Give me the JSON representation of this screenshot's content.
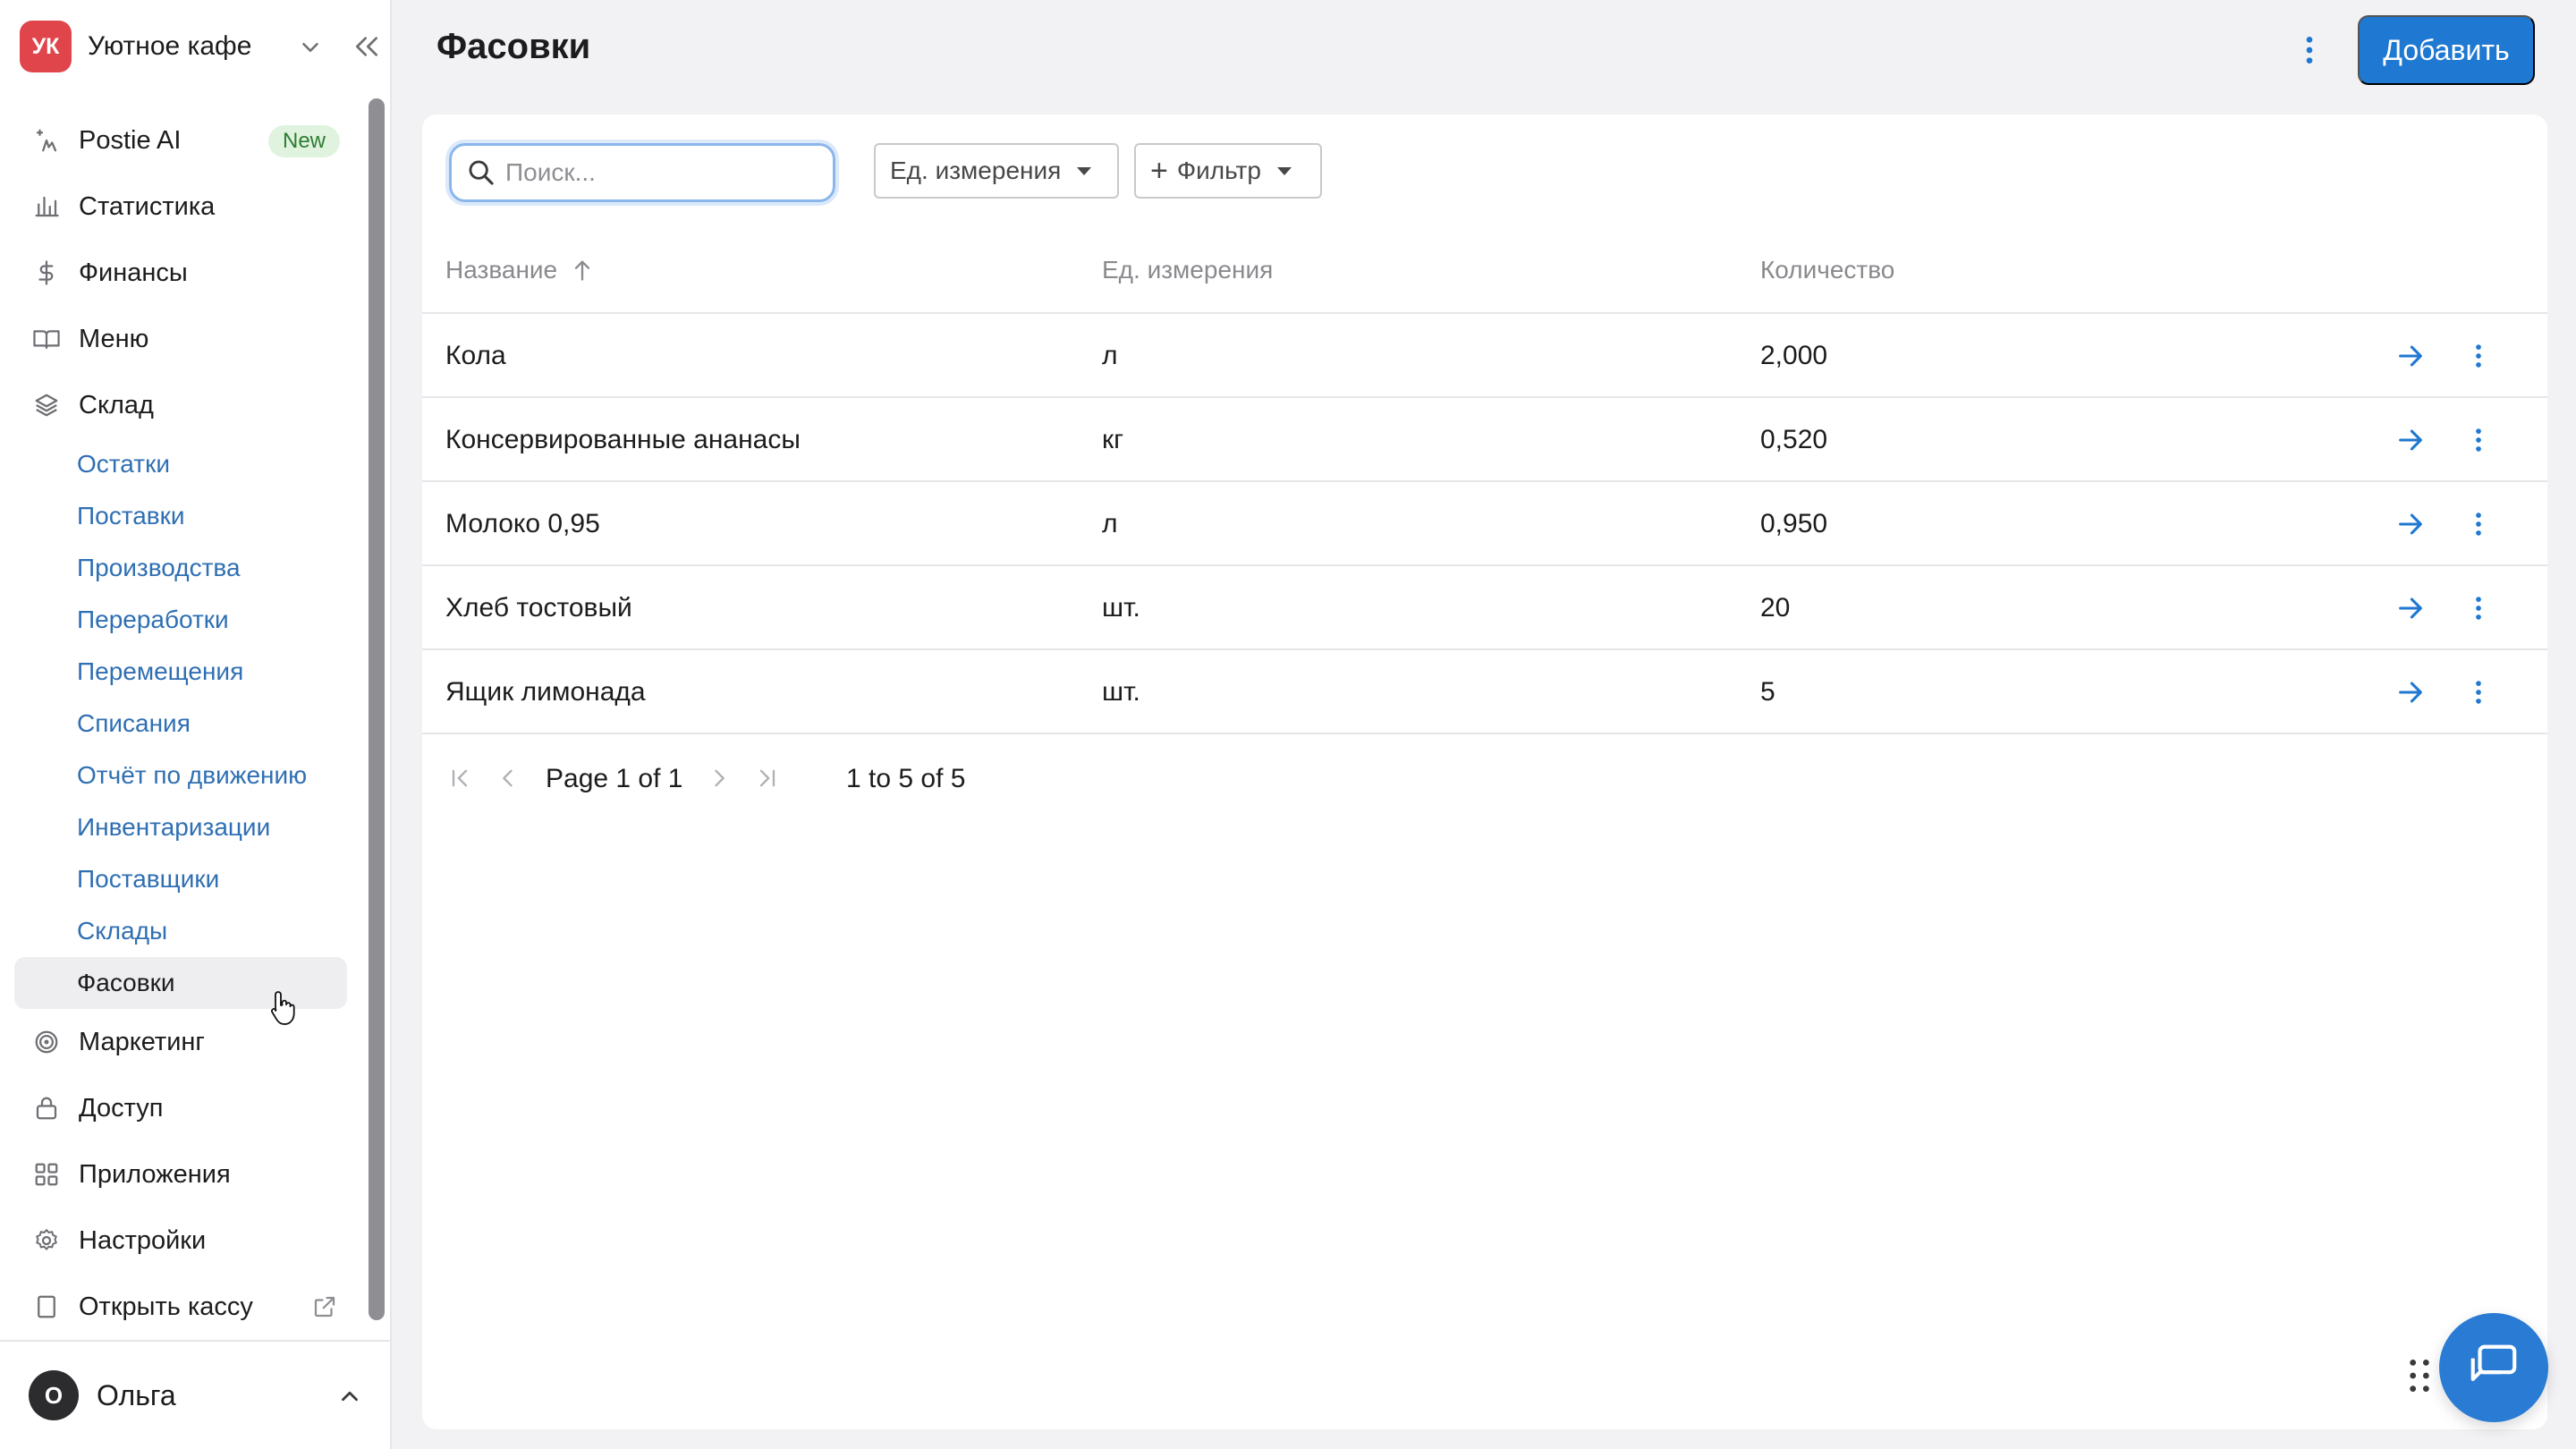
{
  "workspace": {
    "initials": "УК",
    "name": "Уютное кафе",
    "logo_color": "#e0454b"
  },
  "nav": {
    "items": [
      {
        "label": "Postie AI",
        "icon": "sparkle-icon",
        "badge": "New"
      },
      {
        "label": "Статистика",
        "icon": "bar-chart-icon"
      },
      {
        "label": "Финансы",
        "icon": "dollar-icon"
      },
      {
        "label": "Меню",
        "icon": "book-icon"
      },
      {
        "label": "Склад",
        "icon": "layers-icon"
      }
    ],
    "sklad_sub": [
      "Остатки",
      "Поставки",
      "Производства",
      "Переработки",
      "Перемещения",
      "Списания",
      "Отчёт по движению",
      "Инвентаризации",
      "Поставщики",
      "Склады",
      "Фасовки"
    ],
    "items_after": [
      {
        "label": "Маркетинг",
        "icon": "target-icon"
      },
      {
        "label": "Доступ",
        "icon": "lock-icon"
      },
      {
        "label": "Приложения",
        "icon": "grid-icon"
      },
      {
        "label": "Настройки",
        "icon": "gear-icon"
      },
      {
        "label": "Открыть кассу",
        "icon": "tablet-icon"
      }
    ]
  },
  "user": {
    "initial": "О",
    "name": "Ольга"
  },
  "page": {
    "title": "Фасовки",
    "add_label": "Добавить"
  },
  "toolbar": {
    "search_placeholder": "Поиск...",
    "unit_filter_label": "Ед. измерения",
    "filter_label": "Фильтр"
  },
  "table": {
    "columns": [
      "Название",
      "Ед. измерения",
      "Количество"
    ],
    "sort": {
      "column": "Название",
      "direction": "asc"
    },
    "rows": [
      {
        "name": "Кола",
        "unit": "л",
        "qty": "2,000"
      },
      {
        "name": "Консервированные ананасы",
        "unit": "кг",
        "qty": "0,520"
      },
      {
        "name": "Молоко 0,95",
        "unit": "л",
        "qty": "0,950"
      },
      {
        "name": "Хлеб тостовый",
        "unit": "шт.",
        "qty": "20"
      },
      {
        "name": "Ящик лимонада",
        "unit": "шт.",
        "qty": "5"
      }
    ]
  },
  "pagination": {
    "page_text": "Page 1 of 1",
    "range_text": "1 to 5 of 5"
  },
  "colors": {
    "accent": "#1f78d1",
    "link": "#2f6fb3",
    "new_badge_bg": "#dff3df",
    "new_badge_text": "#2f7d32"
  }
}
